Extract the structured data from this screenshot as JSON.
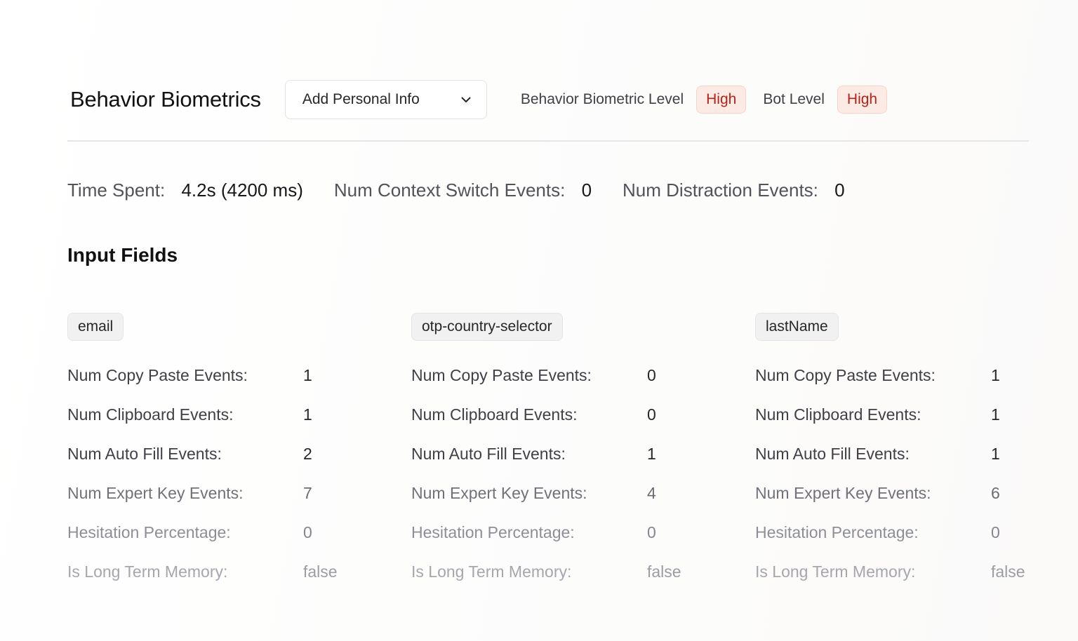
{
  "header": {
    "title": "Behavior Biometrics",
    "select_label": "Add Personal Info",
    "behavior_level_label": "Behavior Biometric Level",
    "behavior_level_value": "High",
    "bot_level_label": "Bot Level",
    "bot_level_value": "High"
  },
  "stats": {
    "time_spent_label": "Time Spent:",
    "time_spent_value": "4.2s (4200 ms)",
    "context_switch_label": "Num Context Switch Events:",
    "context_switch_value": "0",
    "distraction_label": "Num Distraction Events:",
    "distraction_value": "0"
  },
  "section_title": "Input Fields",
  "fields": [
    {
      "name": "email",
      "metrics": [
        {
          "label": "Num Copy Paste Events:",
          "value": "1"
        },
        {
          "label": "Num Clipboard Events:",
          "value": "1"
        },
        {
          "label": "Num Auto Fill Events:",
          "value": "2"
        },
        {
          "label": "Num Expert Key Events:",
          "value": "7"
        },
        {
          "label": "Hesitation Percentage:",
          "value": "0"
        },
        {
          "label": "Is Long Term Memory:",
          "value": "false"
        }
      ]
    },
    {
      "name": "otp-country-selector",
      "metrics": [
        {
          "label": "Num Copy Paste Events:",
          "value": "0"
        },
        {
          "label": "Num Clipboard Events:",
          "value": "0"
        },
        {
          "label": "Num Auto Fill Events:",
          "value": "1"
        },
        {
          "label": "Num Expert Key Events:",
          "value": "4"
        },
        {
          "label": "Hesitation Percentage:",
          "value": "0"
        },
        {
          "label": "Is Long Term Memory:",
          "value": "false"
        }
      ]
    },
    {
      "name": "lastName",
      "metrics": [
        {
          "label": "Num Copy Paste Events:",
          "value": "1"
        },
        {
          "label": "Num Clipboard Events:",
          "value": "1"
        },
        {
          "label": "Num Auto Fill Events:",
          "value": "1"
        },
        {
          "label": "Num Expert Key Events:",
          "value": "6"
        },
        {
          "label": "Hesitation Percentage:",
          "value": "0"
        },
        {
          "label": "Is Long Term Memory:",
          "value": "false"
        }
      ]
    }
  ]
}
